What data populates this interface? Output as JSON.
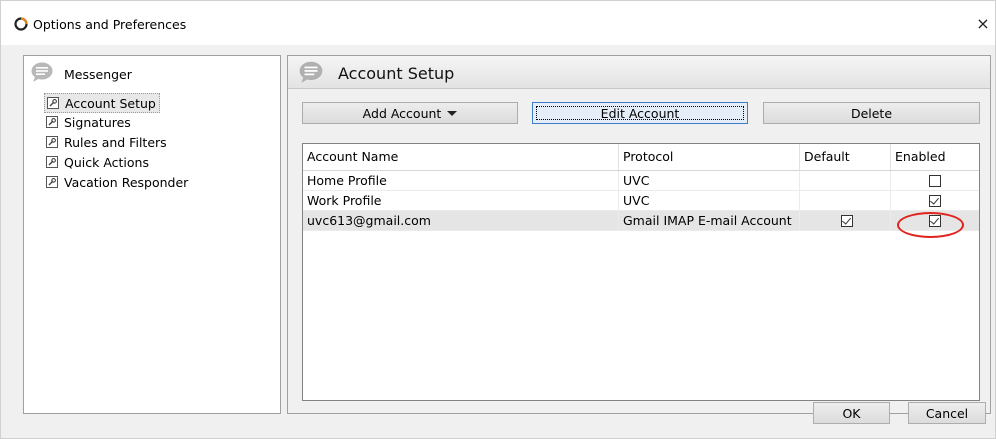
{
  "window": {
    "title": "Options and Preferences",
    "close_label": "×"
  },
  "nav": {
    "root_label": "Messenger",
    "items": [
      {
        "label": "Account Setup",
        "selected": true
      },
      {
        "label": "Signatures"
      },
      {
        "label": "Rules and Filters"
      },
      {
        "label": "Quick Actions"
      },
      {
        "label": "Vacation Responder"
      }
    ]
  },
  "panel": {
    "title": "Account Setup"
  },
  "toolbar": {
    "add_label": "Add Account",
    "edit_label": "Edit Account",
    "delete_label": "Delete"
  },
  "table": {
    "columns": [
      "Account Name",
      "Protocol",
      "Default",
      "Enabled"
    ],
    "rows": [
      {
        "name": "Home Profile",
        "protocol": "UVC",
        "default": false,
        "enabled": false
      },
      {
        "name": "Work Profile",
        "protocol": "UVC",
        "default": false,
        "enabled": true
      },
      {
        "name": "uvc613@gmail.com",
        "protocol": "Gmail IMAP E-mail Account",
        "default": true,
        "enabled": true,
        "selected": true
      }
    ]
  },
  "footer": {
    "ok_label": "OK",
    "cancel_label": "Cancel"
  },
  "colors": {
    "annotation": "#e0231c",
    "focus": "#3d7cc9",
    "app_icon_orange": "#e8821a"
  }
}
